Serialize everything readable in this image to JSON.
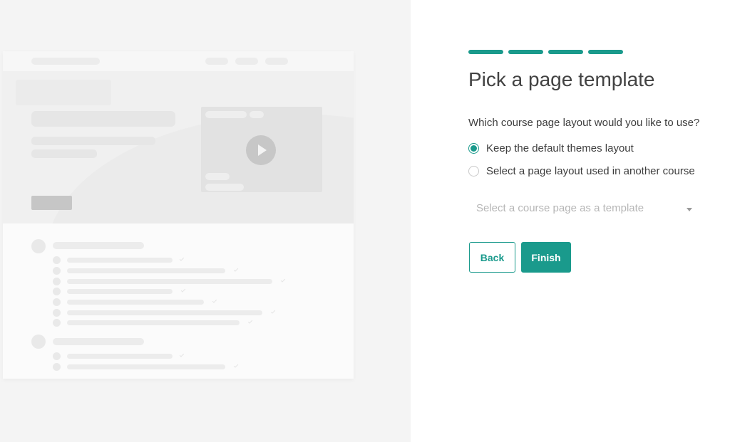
{
  "wizard": {
    "progress_steps": 4,
    "title": "Pick a page template",
    "question": "Which course page layout would you like to use?",
    "options": [
      {
        "label": "Keep the default themes layout",
        "selected": true
      },
      {
        "label": "Select a page layout used in another course",
        "selected": false
      }
    ],
    "template_select": {
      "placeholder": "Select a course page as a template"
    },
    "back_label": "Back",
    "finish_label": "Finish"
  },
  "colors": {
    "accent": "#1a9a8c",
    "preview_background": "#f4f4f4"
  },
  "preview": {
    "icon": "play-icon"
  }
}
